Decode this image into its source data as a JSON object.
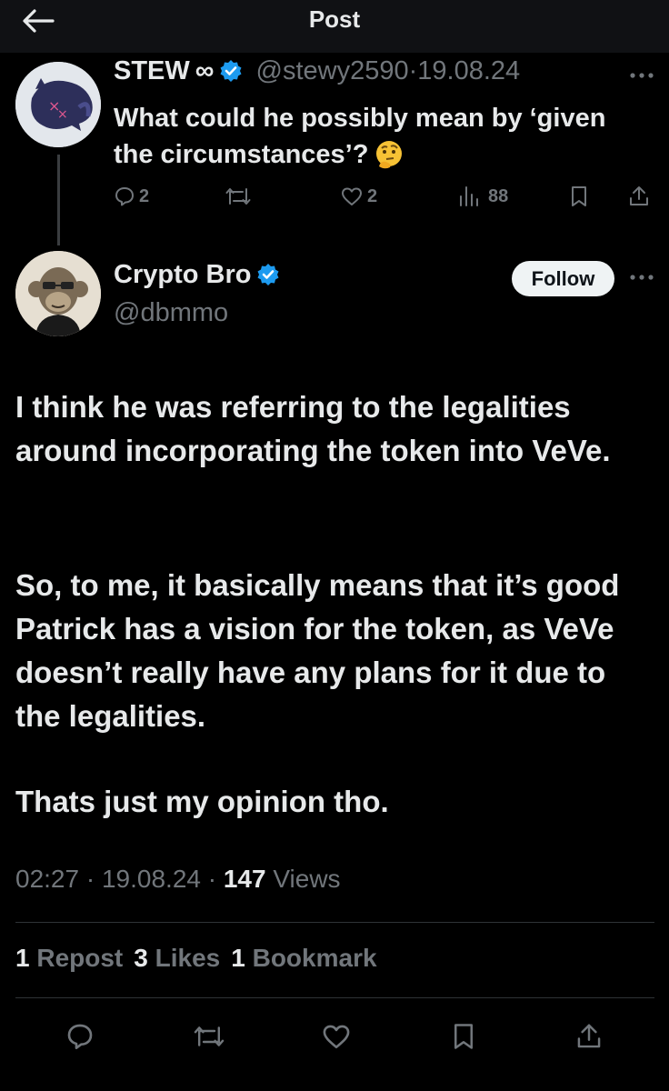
{
  "header": {
    "title": "Post"
  },
  "reply": {
    "author_name": "STEW",
    "author_suffix": "∞",
    "handle": "@stewy2590",
    "separator": "·",
    "date": "19.08.24",
    "text": "What could he possibly mean by ‘given the circumstances’?",
    "emoji": "thinking-face-emoji",
    "actions": {
      "replies": "2",
      "reposts": "",
      "likes": "2",
      "views": "88"
    }
  },
  "post": {
    "author_name": "Crypto Bro",
    "handle": "@dbmmo",
    "follow_label": "Follow",
    "paragraphs": [
      "I think he was referring to the legalities around incorporating the token into VeVe.",
      "So, to me, it basically means that it’s good Patrick has a vision for the token, as VeVe doesn’t really have any plans for it due to the legalities.",
      "Thats just my opinion tho."
    ],
    "meta": {
      "time": "02:27",
      "sep1": "·",
      "date": "19.08.24",
      "sep2": "·",
      "views_count": "147",
      "views_label": "Views"
    },
    "stats": {
      "reposts_count": "1",
      "reposts_label": "Repost",
      "likes_count": "3",
      "likes_label": "Likes",
      "bookmarks_count": "1",
      "bookmarks_label": "Bookmark"
    }
  },
  "colors": {
    "background": "#000000",
    "text": "#e7e9ea",
    "muted": "#71767b",
    "verified": "#1d9bf0",
    "follow_bg": "#eff3f4"
  }
}
